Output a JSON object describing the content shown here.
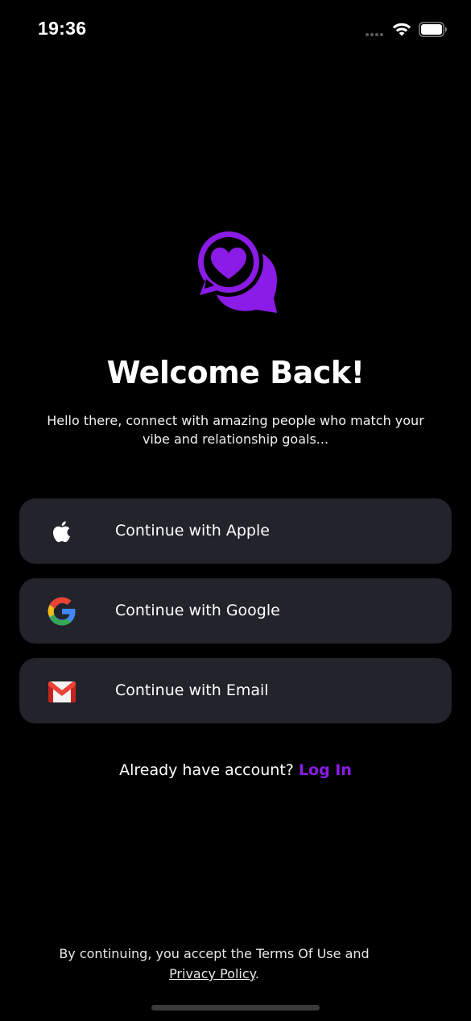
{
  "status_bar": {
    "time": "19:36",
    "signal_icon": "cellular-dots-icon",
    "wifi_icon": "wifi-icon",
    "battery_icon": "battery-icon"
  },
  "logo": {
    "icon": "chat-heart-icon",
    "color": "#8b1be6"
  },
  "header": {
    "title": "Welcome Back!",
    "subtitle": "Hello there, connect with amazing people who match your vibe and relationship goals..."
  },
  "auth_buttons": [
    {
      "label": "Continue with Apple",
      "icon": "apple-icon"
    },
    {
      "label": "Continue with Google",
      "icon": "google-icon"
    },
    {
      "label": "Continue with Email",
      "icon": "gmail-icon"
    }
  ],
  "login": {
    "prompt": "Already have account?",
    "link": "Log In"
  },
  "legal": {
    "prefix": "By continuing, you accept the Terms Of Use and",
    "privacy_link": "Privacy Policy",
    "suffix": "."
  },
  "colors": {
    "background": "#000000",
    "button_bg": "#22232b",
    "accent": "#8b1be6"
  }
}
